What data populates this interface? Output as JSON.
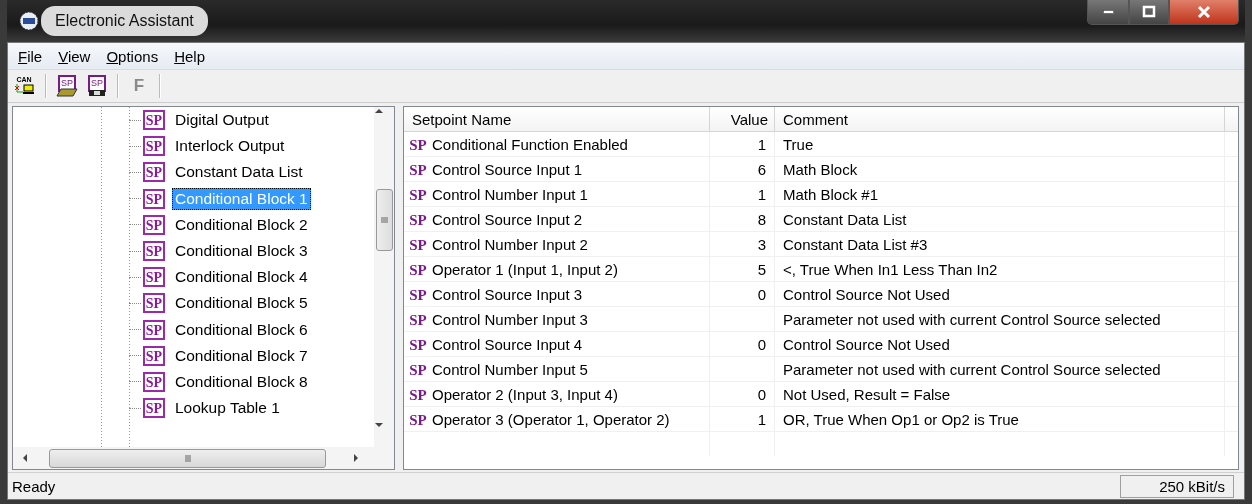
{
  "window": {
    "title": "Electronic Assistant"
  },
  "menu": [
    {
      "label": "File"
    },
    {
      "label": "View"
    },
    {
      "label": "Options"
    },
    {
      "label": "Help"
    }
  ],
  "toolbar": [
    {
      "kind": "can",
      "label": "CAN",
      "disabled": false
    },
    {
      "kind": "open",
      "label": "SP",
      "disabled": false
    },
    {
      "kind": "save",
      "label": "SP",
      "disabled": false
    },
    {
      "kind": "text",
      "label": "F",
      "disabled": true
    }
  ],
  "tree": {
    "items": [
      {
        "icon": "SP",
        "label": "Digital Output",
        "selected": false
      },
      {
        "icon": "SP",
        "label": "Interlock Output",
        "selected": false
      },
      {
        "icon": "SP",
        "label": "Constant Data List",
        "selected": false
      },
      {
        "icon": "SP",
        "label": "Conditional Block 1",
        "selected": true
      },
      {
        "icon": "SP",
        "label": "Conditional Block 2",
        "selected": false
      },
      {
        "icon": "SP",
        "label": "Conditional Block 3",
        "selected": false
      },
      {
        "icon": "SP",
        "label": "Conditional Block 4",
        "selected": false
      },
      {
        "icon": "SP",
        "label": "Conditional Block 5",
        "selected": false
      },
      {
        "icon": "SP",
        "label": "Conditional Block 6",
        "selected": false
      },
      {
        "icon": "SP",
        "label": "Conditional Block 7",
        "selected": false
      },
      {
        "icon": "SP",
        "label": "Conditional Block 8",
        "selected": false
      },
      {
        "icon": "SP",
        "label": "Lookup Table 1",
        "selected": false
      }
    ]
  },
  "table": {
    "columns": [
      "Setpoint Name",
      "Value",
      "Comment"
    ],
    "rows": [
      {
        "icon": "SP",
        "name": "Conditional Function Enabled",
        "value": "1",
        "comment": "True"
      },
      {
        "icon": "SP",
        "name": "Control Source Input 1",
        "value": "6",
        "comment": "Math Block"
      },
      {
        "icon": "SP",
        "name": "Control Number Input 1",
        "value": "1",
        "comment": "Math Block #1"
      },
      {
        "icon": "SP",
        "name": "Control Source Input 2",
        "value": "8",
        "comment": "Constant Data List"
      },
      {
        "icon": "SP",
        "name": "Control Number Input 2",
        "value": "3",
        "comment": "Constant Data List #3"
      },
      {
        "icon": "SP",
        "name": "Operator 1 (Input 1, Input 2)",
        "value": "5",
        "comment": "<, True When In1 Less Than In2"
      },
      {
        "icon": "SP",
        "name": "Control Source Input 3",
        "value": "0",
        "comment": "Control Source Not Used"
      },
      {
        "icon": "SP",
        "name": "Control Number Input 3",
        "comment": "Parameter not used with current Control Source selected"
      },
      {
        "icon": "SP",
        "name": "Control Source Input 4",
        "value": "0",
        "comment": "Control Source Not Used"
      },
      {
        "icon": "SP",
        "name": "Control Number Input 5",
        "comment": "Parameter not used with current Control Source selected"
      },
      {
        "icon": "SP",
        "name": "Operator 2 (Input 3, Input 4)",
        "value": "0",
        "comment": "Not Used, Result = False"
      },
      {
        "icon": "SP",
        "name": "Operator 3 (Operator 1, Operator 2)",
        "value": "1",
        "comment": "OR, True When Op1 or Op2 is True"
      }
    ]
  },
  "status_bar": {
    "message": "Ready",
    "baud": "250 kBit/s"
  }
}
